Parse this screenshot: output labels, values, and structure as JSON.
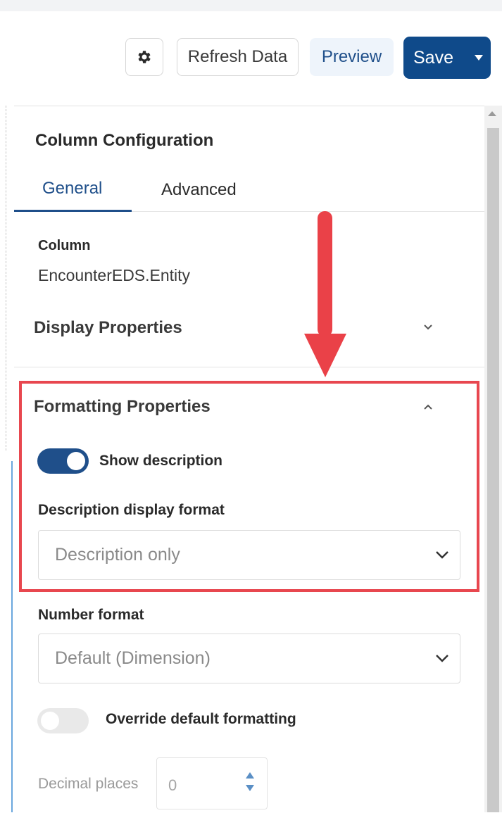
{
  "toolbar": {
    "settings_icon": "gear-icon",
    "refresh_label": "Refresh Data",
    "preview_label": "Preview",
    "save_label": "Save",
    "save_dropdown_icon": "caret-down-icon"
  },
  "panel": {
    "title": "Column Configuration",
    "tabs": [
      {
        "label": "General",
        "active": true
      },
      {
        "label": "Advanced",
        "active": false
      }
    ],
    "column": {
      "label": "Column",
      "value": "EncounterEDS.Entity"
    },
    "display_properties": {
      "label": "Display Properties",
      "expanded": false
    },
    "formatting_properties": {
      "label": "Formatting Properties",
      "expanded": true,
      "show_description": {
        "label": "Show description",
        "on": true
      },
      "description_format": {
        "label": "Description display format",
        "value": "Description only"
      },
      "number_format": {
        "label": "Number format",
        "value": "Default (Dimension)"
      },
      "override_formatting": {
        "label": "Override default formatting",
        "on": false
      },
      "decimal_places": {
        "label": "Decimal places",
        "value": "0"
      }
    }
  },
  "colors": {
    "primary": "#0f4a8a",
    "annotation_red": "#e8474f",
    "preview_bg": "#eef4fb"
  }
}
